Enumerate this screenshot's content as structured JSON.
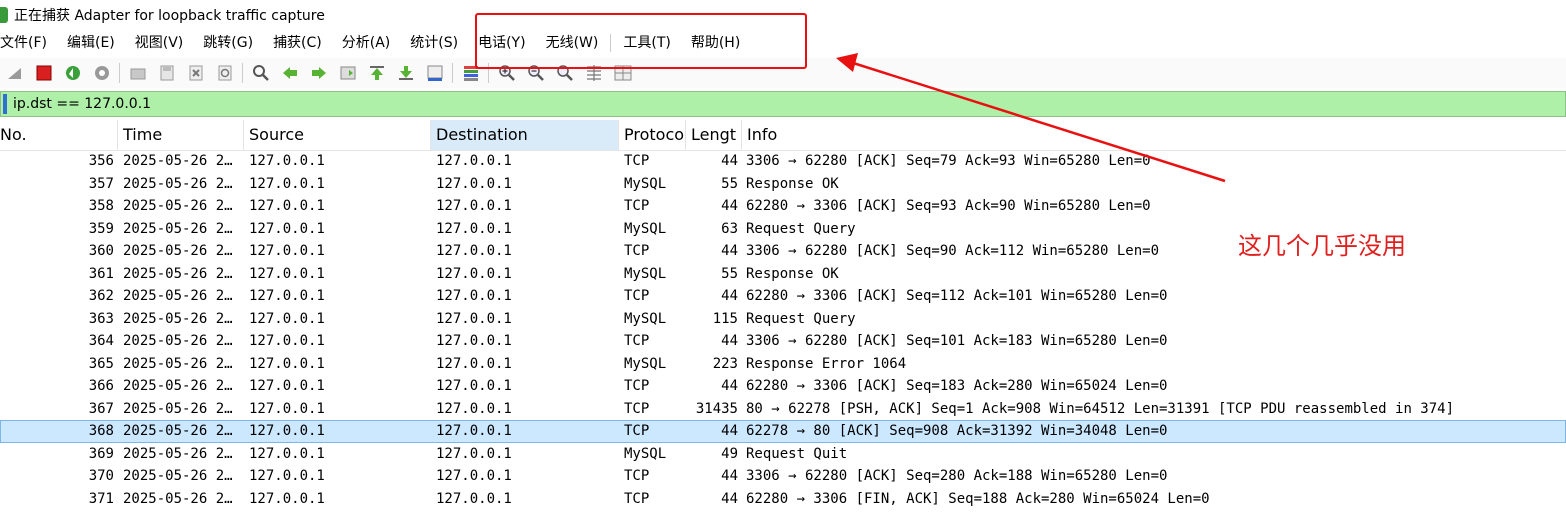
{
  "window": {
    "title": "正在捕获 Adapter for loopback traffic capture"
  },
  "menu": [
    "文件(F)",
    "编辑(E)",
    "视图(V)",
    "跳转(G)",
    "捕获(C)",
    "分析(A)",
    "统计(S)",
    "电话(Y)",
    "无线(W)",
    "工具(T)",
    "帮助(H)"
  ],
  "toolbar_icons": [
    "shark-fin-icon",
    "stop-capture-icon",
    "restart-capture-icon",
    "capture-options-icon",
    "open-file-icon",
    "save-file-icon",
    "close-file-icon",
    "reload-icon",
    "find-packet-icon",
    "go-back-icon",
    "go-forward-icon",
    "go-to-packet-icon",
    "go-first-icon",
    "go-last-icon",
    "auto-scroll-icon",
    "colorize-icon",
    "zoom-in-icon",
    "zoom-out-icon",
    "zoom-normal-icon",
    "resize-columns-icon",
    "expand-subtrees-icon"
  ],
  "filter": {
    "value": "ip.dst == 127.0.0.1"
  },
  "columns": [
    "No.",
    "Time",
    "Source",
    "Destination",
    "Protoco",
    "Lengt",
    "Info"
  ],
  "sorted_column": "Destination",
  "packets": [
    {
      "no": "356",
      "time": "2025-05-26 2…",
      "src": "127.0.0.1",
      "dst": "127.0.0.1",
      "proto": "TCP",
      "len": "44",
      "info": "3306 → 62280 [ACK] Seq=79 Ack=93 Win=65280 Len=0"
    },
    {
      "no": "357",
      "time": "2025-05-26 2…",
      "src": "127.0.0.1",
      "dst": "127.0.0.1",
      "proto": "MySQL",
      "len": "55",
      "info": "Response  OK"
    },
    {
      "no": "358",
      "time": "2025-05-26 2…",
      "src": "127.0.0.1",
      "dst": "127.0.0.1",
      "proto": "TCP",
      "len": "44",
      "info": "62280 → 3306 [ACK] Seq=93 Ack=90 Win=65280 Len=0"
    },
    {
      "no": "359",
      "time": "2025-05-26 2…",
      "src": "127.0.0.1",
      "dst": "127.0.0.1",
      "proto": "MySQL",
      "len": "63",
      "info": "Request Query"
    },
    {
      "no": "360",
      "time": "2025-05-26 2…",
      "src": "127.0.0.1",
      "dst": "127.0.0.1",
      "proto": "TCP",
      "len": "44",
      "info": "3306 → 62280 [ACK] Seq=90 Ack=112 Win=65280 Len=0"
    },
    {
      "no": "361",
      "time": "2025-05-26 2…",
      "src": "127.0.0.1",
      "dst": "127.0.0.1",
      "proto": "MySQL",
      "len": "55",
      "info": "Response  OK"
    },
    {
      "no": "362",
      "time": "2025-05-26 2…",
      "src": "127.0.0.1",
      "dst": "127.0.0.1",
      "proto": "TCP",
      "len": "44",
      "info": "62280 → 3306 [ACK] Seq=112 Ack=101 Win=65280 Len=0"
    },
    {
      "no": "363",
      "time": "2025-05-26 2…",
      "src": "127.0.0.1",
      "dst": "127.0.0.1",
      "proto": "MySQL",
      "len": "115",
      "info": "Request Query"
    },
    {
      "no": "364",
      "time": "2025-05-26 2…",
      "src": "127.0.0.1",
      "dst": "127.0.0.1",
      "proto": "TCP",
      "len": "44",
      "info": "3306 → 62280 [ACK] Seq=101 Ack=183 Win=65280 Len=0"
    },
    {
      "no": "365",
      "time": "2025-05-26 2…",
      "src": "127.0.0.1",
      "dst": "127.0.0.1",
      "proto": "MySQL",
      "len": "223",
      "info": "Response  Error 1064"
    },
    {
      "no": "366",
      "time": "2025-05-26 2…",
      "src": "127.0.0.1",
      "dst": "127.0.0.1",
      "proto": "TCP",
      "len": "44",
      "info": "62280 → 3306 [ACK] Seq=183 Ack=280 Win=65024 Len=0"
    },
    {
      "no": "367",
      "time": "2025-05-26 2…",
      "src": "127.0.0.1",
      "dst": "127.0.0.1",
      "proto": "TCP",
      "len": "31435",
      "info": "80 → 62278 [PSH, ACK] Seq=1 Ack=908 Win=64512 Len=31391 [TCP PDU reassembled in 374]"
    },
    {
      "no": "368",
      "time": "2025-05-26 2…",
      "src": "127.0.0.1",
      "dst": "127.0.0.1",
      "proto": "TCP",
      "len": "44",
      "info": "62278 → 80 [ACK] Seq=908 Ack=31392 Win=34048 Len=0",
      "selected": true
    },
    {
      "no": "369",
      "time": "2025-05-26 2…",
      "src": "127.0.0.1",
      "dst": "127.0.0.1",
      "proto": "MySQL",
      "len": "49",
      "info": "Request Quit"
    },
    {
      "no": "370",
      "time": "2025-05-26 2…",
      "src": "127.0.0.1",
      "dst": "127.0.0.1",
      "proto": "TCP",
      "len": "44",
      "info": "3306 → 62280 [ACK] Seq=280 Ack=188 Win=65280 Len=0"
    },
    {
      "no": "371",
      "time": "2025-05-26 2…",
      "src": "127.0.0.1",
      "dst": "127.0.0.1",
      "proto": "TCP",
      "len": "44",
      "info": "62280 → 3306 [FIN, ACK] Seq=188 Ack=280 Win=65024 Len=0"
    }
  ],
  "annotation": {
    "text": "这几个几乎没用",
    "color": "#e01f1f"
  },
  "colors": {
    "filter_bg": "#aef0a7",
    "selected_row": "#cce8ff",
    "sorted_header": "#d9ebf9",
    "annotation_red": "#e81010"
  }
}
